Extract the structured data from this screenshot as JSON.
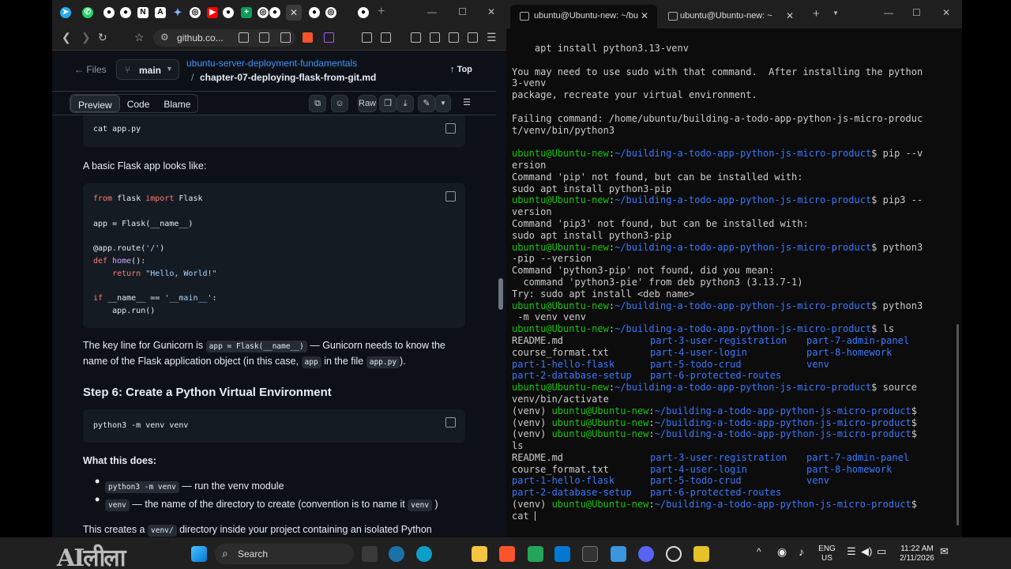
{
  "browser": {
    "url": "github.co...",
    "tab_close": "✕",
    "header": {
      "files_label": "Files",
      "branch": "main",
      "repo": "ubuntu-server-deployment-fundamentals",
      "path_sep": "/",
      "file": "chapter-07-deploying-flask-from-git.md",
      "top_label": "Top"
    },
    "toolbar": {
      "preview": "Preview",
      "code": "Code",
      "blame": "Blame",
      "raw": "Raw"
    },
    "content": {
      "cmd1": "cat app.py",
      "para1": "A basic Flask app looks like:",
      "code2": {
        "l1_kw": "from",
        "l1_a": " flask ",
        "l1_kw2": "import",
        "l1_b": " Flask",
        "l2": "app = Flask(__name__)",
        "l3_a": "@app.route(",
        "l3_s": "'/'",
        "l3_b": ")",
        "l4_kw": "def",
        "l4_fn": " home",
        "l4_b": "():",
        "l5_kw": "    return",
        "l5_s": " \"Hello, World!\"",
        "l6_kw": "if",
        "l6_a": " __name__ == ",
        "l6_s": "'__main__'",
        "l6_b": ":",
        "l7": "    app.run()"
      },
      "p2_a": "The key line for Gunicorn is",
      "p2_code": "app = Flask(__name__)",
      "p2_b": "— Gunicorn needs to know the",
      "p3_a": "name of the Flask application object (in this case,",
      "p3_code1": "app",
      "p3_b": "in the file",
      "p3_code2": "app.py",
      "p3_c": ").",
      "h_step6": "Step 6: Create a Python Virtual Environment",
      "cmd3": "python3 -m venv venv",
      "what_label": "What this does:",
      "b1_code": "python3 -m venv",
      "b1_text": "— run the venv module",
      "b2_code": "venv",
      "b2_text": "— the name of the directory to create (convention is to name it",
      "b2_code2": "venv",
      "b2_end": ")",
      "p4_a": "This creates a",
      "p4_code": "venv/",
      "p4_b": "directory inside your project containing an isolated Python"
    }
  },
  "terminal": {
    "tab1": "ubuntu@Ubuntu-new: ~/bu",
    "tab2": "ubuntu@Ubuntu-new: ~",
    "prompt_user": "ubuntu@Ubuntu-new",
    "prompt_path": "~/building-a-todo-app-python-js-micro-product",
    "lines": {
      "l01": "    apt install python3.13-venv",
      "l03": "You may need to use sudo with that command.  After installing the python",
      "l04": "3-venv",
      "l05": "package, recreate your virtual environment.",
      "l07": "Failing command: /home/ubuntu/building-a-todo-app-python-js-micro-produc",
      "l08": "t/venv/bin/python3",
      "c10": "$ pip --v",
      "l11": "ersion",
      "l12": "Command 'pip' not found, but can be installed with:",
      "l13": "sudo apt install python3-pip",
      "c14": "$ pip3 --",
      "l15": "version",
      "l16": "Command 'pip3' not found, but can be installed with:",
      "l17": "sudo apt install python3-pip",
      "c18": "$ python3",
      "l19": "-pip --version",
      "l20": "Command 'python3-pip' not found, did you mean:",
      "l21": "  command 'python3-pie' from deb python3 (3.13.7-1)",
      "l22": "Try: sudo apt install <deb name>",
      "c23": "$ python3",
      "l24": " -m venv venv",
      "c25": "$ ls",
      "ls_readme": "README.md",
      "ls_course": "course_format.txt",
      "ls_p1": "part-1-hello-flask",
      "ls_p2": "part-2-database-setup",
      "ls_p3": "part-3-user-registration",
      "ls_p4": "part-4-user-login",
      "ls_p5": "part-5-todo-crud",
      "ls_p6": "part-6-protected-routes",
      "ls_p7": "part-7-admin-panel",
      "ls_p8": "part-8-homework",
      "ls_venv": "venv",
      "c30": "$ source",
      "l31": "venv/bin/activate",
      "venv_prefix": "(venv) ",
      "dollar": "$",
      "l35": "ls",
      "last_cmd": "cat "
    }
  },
  "taskbar": {
    "logo": "AIलीला",
    "search": "Search",
    "lang1": "ENG",
    "lang2": "US",
    "time": "11:22 AM",
    "date": "2/11/2026"
  }
}
